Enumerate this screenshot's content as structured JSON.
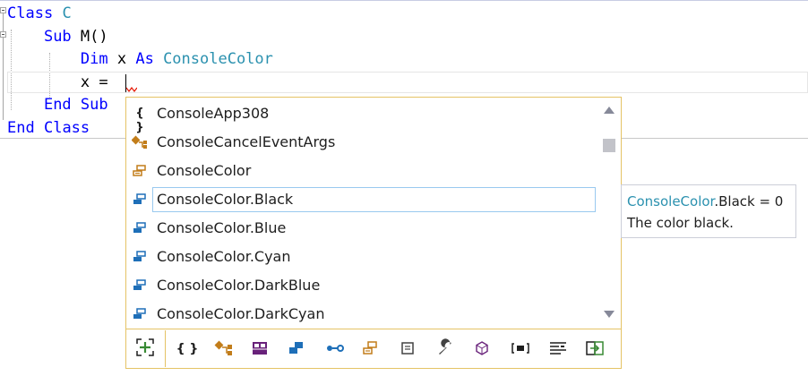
{
  "editor": {
    "lines": [
      {
        "kw1": "Class",
        "rest": " ",
        "type": "C"
      },
      {
        "indent": "    ",
        "kw1": "Sub",
        "rest": " M()"
      },
      {
        "indent": "        ",
        "kw1": "Dim",
        "mid": " x ",
        "kw2": "As",
        "sp": " ",
        "type": "ConsoleColor"
      },
      {
        "indent": "        ",
        "text": "x = "
      },
      {
        "indent": "    ",
        "kw1": "End",
        "sp": " ",
        "kw2": "Sub"
      },
      {
        "kw1": "End",
        "sp": " ",
        "kw2": "Class"
      }
    ]
  },
  "completion": {
    "items": [
      {
        "label": "ConsoleApp308",
        "icon": "namespace-icon"
      },
      {
        "label": "ConsoleCancelEventArgs",
        "icon": "class-icon"
      },
      {
        "label": "ConsoleColor",
        "icon": "enum-icon"
      },
      {
        "label": "ConsoleColor.Black",
        "icon": "enum-member-icon",
        "selected": true
      },
      {
        "label": "ConsoleColor.Blue",
        "icon": "enum-member-icon"
      },
      {
        "label": "ConsoleColor.Cyan",
        "icon": "enum-member-icon"
      },
      {
        "label": "ConsoleColor.DarkBlue",
        "icon": "enum-member-icon"
      },
      {
        "label": "ConsoleColor.DarkCyan",
        "icon": "enum-member-icon"
      }
    ],
    "filters": [
      "namespaces-filter-icon",
      "classes-filter-icon",
      "modules-filter-icon",
      "structures-filter-icon",
      "interfaces-filter-icon",
      "enums-filter-icon",
      "delegates-filter-icon",
      "properties-filter-icon",
      "events-filter-icon",
      "fields-filter-icon",
      "keywords-filter-icon",
      "snippets-filter-icon"
    ]
  },
  "tooltip": {
    "type": "ConsoleColor",
    "member": ".Black = 0",
    "description": "The color black."
  },
  "colors": {
    "keyword": "#0000ff",
    "type": "#2b91af",
    "popup_border": "#e5c365",
    "selection_border": "#99c9ef"
  }
}
